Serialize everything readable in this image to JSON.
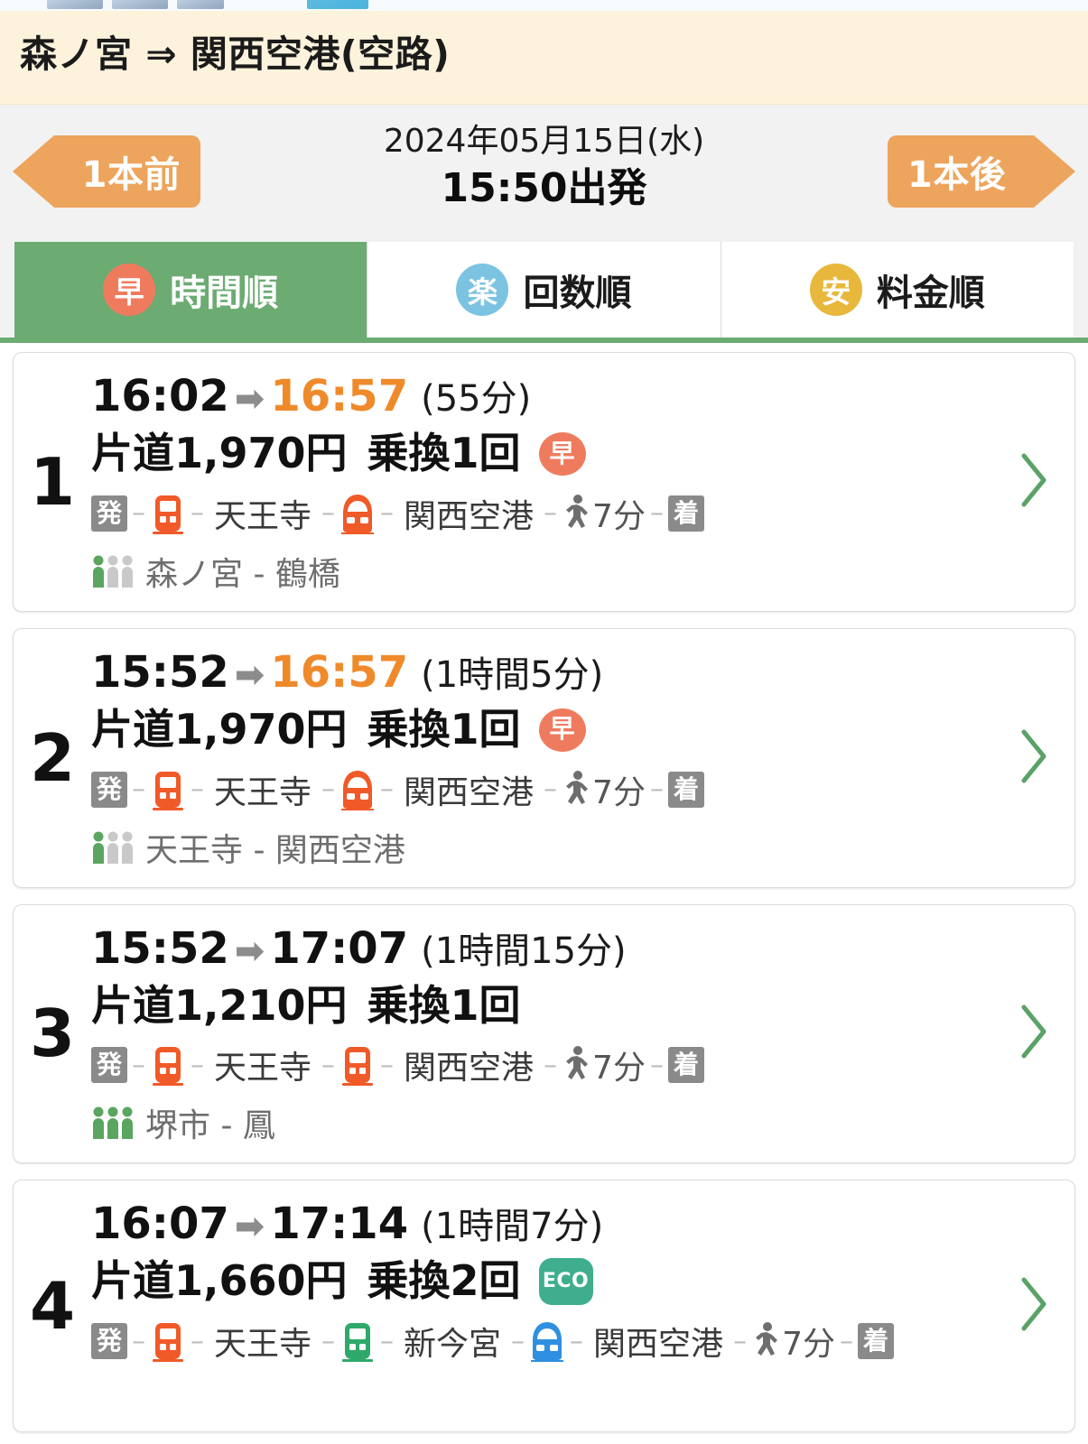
{
  "header": {
    "route_title": "森ノ宮 ⇒ 関西空港(空路)"
  },
  "datenav": {
    "prev_label": "1本前",
    "next_label": "1本後",
    "date": "2024年05月15日(水)",
    "departure": "15:50出発"
  },
  "tabs": [
    {
      "icon_label": "早",
      "label": "時間順",
      "icon_name": "hayai-icon",
      "active": true
    },
    {
      "icon_label": "楽",
      "label": "回数順",
      "icon_name": "raku-icon",
      "active": false
    },
    {
      "icon_label": "安",
      "label": "料金順",
      "icon_name": "yasui-icon",
      "active": false
    }
  ],
  "colors": {
    "accent_orange": "#eda45c",
    "header_cream": "#fdf3dd",
    "active_tab_green": "#6cab72",
    "arrive_highlight": "#ef8a2b",
    "badge_hayai": "#ef7b5e",
    "badge_eco": "#3fae8e",
    "badge_raku": "#7cc3e2",
    "badge_yasui": "#e8b83c",
    "train_orange": "#f05a28",
    "train_green": "#2fa96a",
    "train_blue": "#2f8fe0",
    "chevron_green": "#5aa267",
    "crowd_green": "#5aa55f",
    "crowd_gray": "#c9c9c9"
  },
  "results": [
    {
      "rank": "1",
      "depart": "16:02",
      "arrive": "16:57",
      "arrive_highlight": true,
      "duration": "(55分)",
      "fare": "片道1,970円",
      "transfers": "乗換1回",
      "badge": "早",
      "badge_type": "hayai",
      "start_cap": "発",
      "end_cap": "着",
      "walk": "7分",
      "legs": [
        {
          "train_color": "train_orange",
          "train_type": "local",
          "stop": "天王寺"
        },
        {
          "train_color": "train_orange",
          "train_type": "express",
          "stop": "関西空港"
        }
      ],
      "crowd_level": 1,
      "crowd_text": "森ノ宮 - 鶴橋"
    },
    {
      "rank": "2",
      "depart": "15:52",
      "arrive": "16:57",
      "arrive_highlight": true,
      "duration": "(1時間5分)",
      "fare": "片道1,970円",
      "transfers": "乗換1回",
      "badge": "早",
      "badge_type": "hayai",
      "start_cap": "発",
      "end_cap": "着",
      "walk": "7分",
      "legs": [
        {
          "train_color": "train_orange",
          "train_type": "local",
          "stop": "天王寺"
        },
        {
          "train_color": "train_orange",
          "train_type": "express",
          "stop": "関西空港"
        }
      ],
      "crowd_level": 1,
      "crowd_text": "天王寺 - 関西空港"
    },
    {
      "rank": "3",
      "depart": "15:52",
      "arrive": "17:07",
      "arrive_highlight": false,
      "duration": "(1時間15分)",
      "fare": "片道1,210円",
      "transfers": "乗換1回",
      "badge": "",
      "badge_type": "none",
      "start_cap": "発",
      "end_cap": "着",
      "walk": "7分",
      "legs": [
        {
          "train_color": "train_orange",
          "train_type": "local",
          "stop": "天王寺"
        },
        {
          "train_color": "train_orange",
          "train_type": "local",
          "stop": "関西空港"
        }
      ],
      "crowd_level": 3,
      "crowd_text": "堺市 - 鳳"
    },
    {
      "rank": "4",
      "depart": "16:07",
      "arrive": "17:14",
      "arrive_highlight": false,
      "duration": "(1時間7分)",
      "fare": "片道1,660円",
      "transfers": "乗換2回",
      "badge": "ECO",
      "badge_type": "eco",
      "start_cap": "発",
      "end_cap": "着",
      "walk": "7分",
      "legs": [
        {
          "train_color": "train_orange",
          "train_type": "local",
          "stop": "天王寺"
        },
        {
          "train_color": "train_green",
          "train_type": "local",
          "stop": "新今宮"
        },
        {
          "train_color": "train_blue",
          "train_type": "express",
          "stop": "関西空港"
        }
      ],
      "crowd_level": 0,
      "crowd_text": ""
    }
  ]
}
